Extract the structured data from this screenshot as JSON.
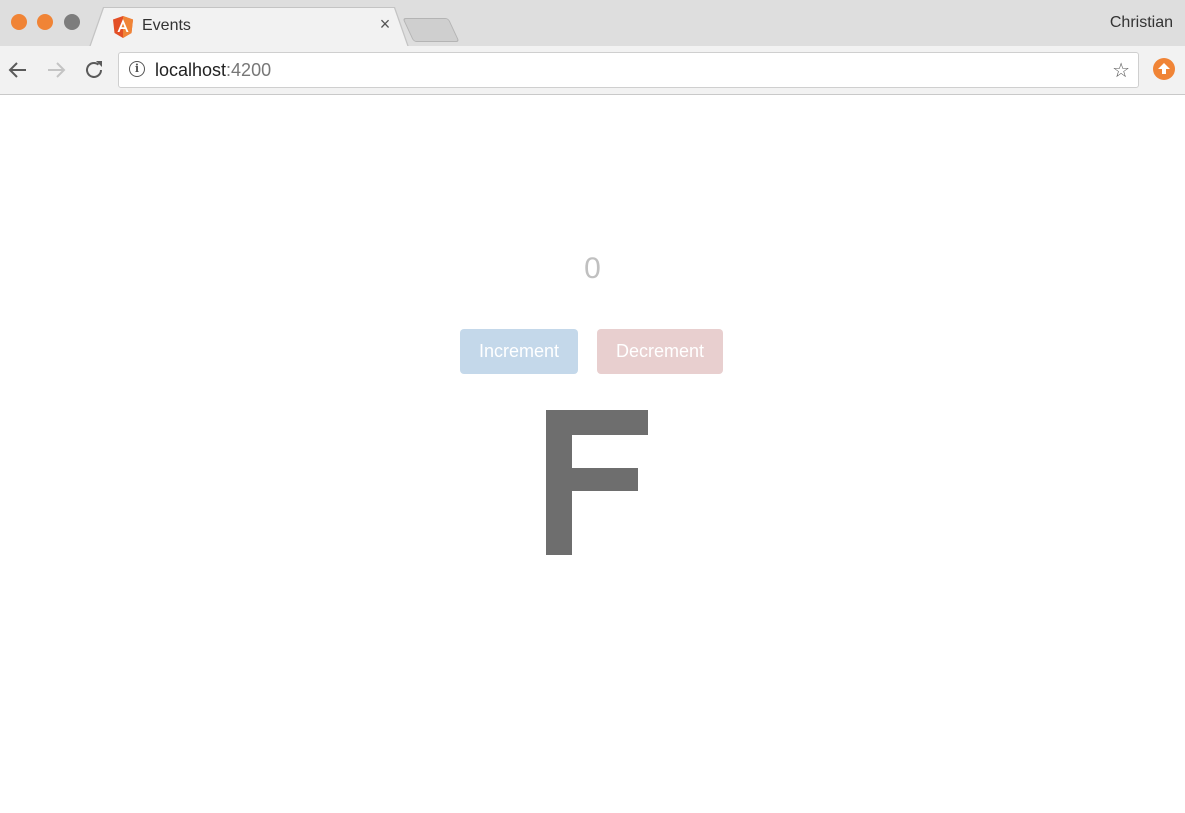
{
  "browser": {
    "tab": {
      "title": "Events",
      "favicon": "angular-icon",
      "close_glyph": "×"
    },
    "profile_name": "Christian",
    "address_bar": {
      "host": "localhost",
      "port": ":4200"
    }
  },
  "page": {
    "counter_value": "0",
    "increment_label": "Increment",
    "decrement_label": "Decrement",
    "big_letter": "F"
  },
  "colors": {
    "traffic_light": "#f08436",
    "increment_bg": "#c4d8ea",
    "decrement_bg": "#e8cfcf",
    "letter": "#6e6e6e"
  }
}
